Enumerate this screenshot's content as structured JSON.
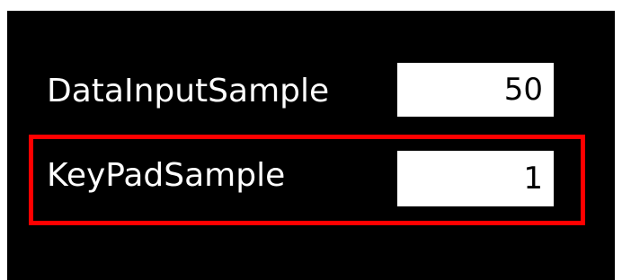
{
  "rows": [
    {
      "label": "DataInputSample",
      "value": "50"
    },
    {
      "label": "KeyPadSample",
      "value": "1"
    }
  ],
  "colors": {
    "background": "#000000",
    "text": "#ffffff",
    "field_background": "#ffffff",
    "field_text": "#000000",
    "highlight": "#ff0000"
  }
}
